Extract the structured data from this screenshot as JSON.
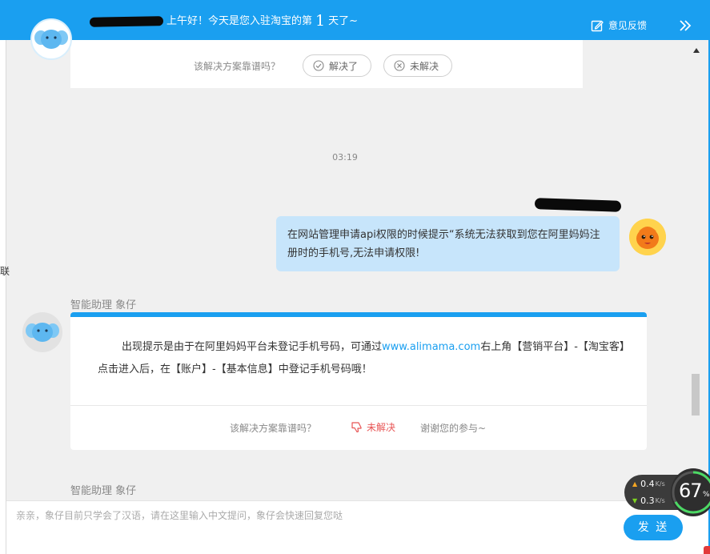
{
  "header": {
    "greeting": "上午好！今天是您入驻淘宝的第",
    "day_count": "1",
    "greeting_suffix": "天了~",
    "feedback_label": "意见反馈",
    "brand_color": "#1a9ff0"
  },
  "scrollbar": {
    "thumb_position": 0.8
  },
  "messages": {
    "card1": {
      "rate_question": "该解决方案靠谱吗？",
      "resolved_label": "解决了",
      "unresolved_label": "未解决"
    },
    "timestamp": "03:19",
    "user_message": "在网站管理申请api权限的时候提示“系统无法获取到您在阿里妈妈注册时的手机号,无法申请权限!",
    "bot_name": "智能助理 象仔",
    "bot_answer": {
      "text_before": "出现提示是由于在阿里妈妈平台未登记手机号码，可通过",
      "link": "www.alimama.com",
      "text_after": "右上角【营销平台】-【淘宝客】点击进入后，在【账户】-【基本信息】中登记手机号码哦！"
    },
    "card2": {
      "rate_question": "该解决方案靠谱吗？",
      "unresolved_label": "未解决",
      "thanks": "谢谢您的参与~"
    },
    "bot_name_2": "智能助理 象仔"
  },
  "input": {
    "placeholder": "亲亲，象仔目前只学会了汉语，请在这里输入中文提问，象仔会快速回复您哒",
    "send_label": "发 送"
  },
  "net_widget": {
    "upload": "0.4",
    "download": "0.3",
    "unit": "K/s",
    "percent": "67",
    "percent_sign": "%"
  },
  "left_fragment": "联"
}
